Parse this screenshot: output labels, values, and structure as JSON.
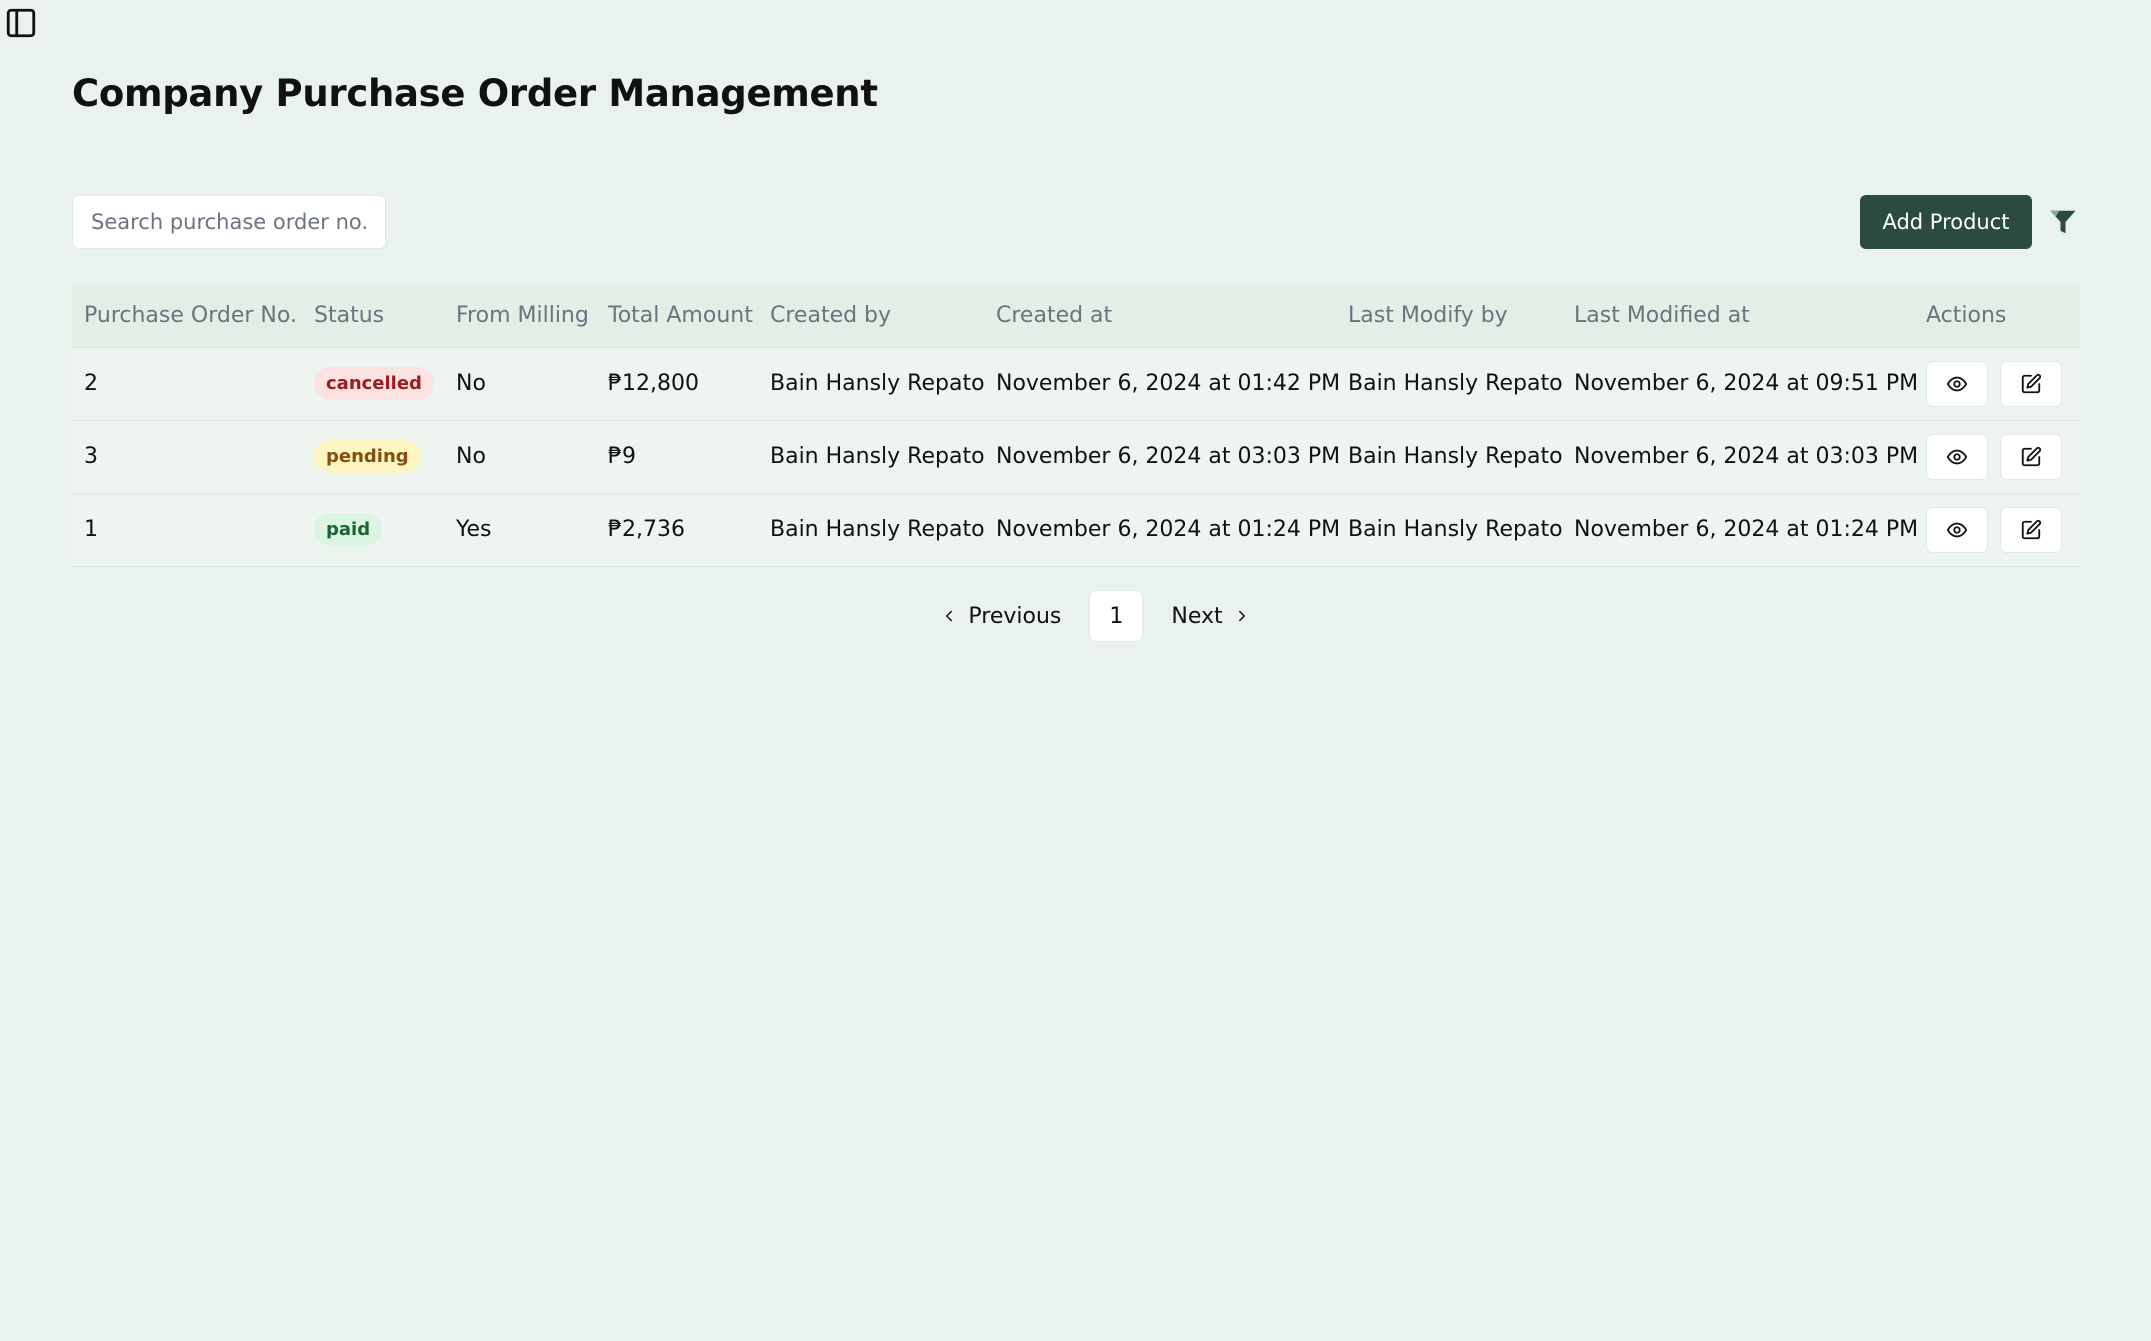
{
  "page": {
    "title": "Company Purchase Order Management"
  },
  "toolbar": {
    "search_placeholder": "Search purchase order no. . .",
    "add_button_label": "Add Product"
  },
  "icons": {
    "sidebar_toggle": "panel-left-icon",
    "filter": "filter-icon",
    "view": "eye-icon",
    "edit": "edit-icon",
    "prev": "chevron-left-icon",
    "next": "chevron-right-icon"
  },
  "table": {
    "columns": [
      "Purchase Order No.",
      "Status",
      "From Milling",
      "Total Amount",
      "Created by",
      "Created at",
      "Last Modify by",
      "Last Modified at",
      "Actions"
    ],
    "rows": [
      {
        "po_no": "2",
        "status": "cancelled",
        "from_milling": "No",
        "total_amount": "₱12,800",
        "created_by": "Bain Hansly Repato",
        "created_at": "November 6, 2024 at 01:42 PM",
        "last_modify_by": "Bain Hansly Repato",
        "last_modified_at": "November 6, 2024 at 09:51 PM"
      },
      {
        "po_no": "3",
        "status": "pending",
        "from_milling": "No",
        "total_amount": "₱9",
        "created_by": "Bain Hansly Repato",
        "created_at": "November 6, 2024 at 03:03 PM",
        "last_modify_by": "Bain Hansly Repato",
        "last_modified_at": "November 6, 2024 at 03:03 PM"
      },
      {
        "po_no": "1",
        "status": "paid",
        "from_milling": "Yes",
        "total_amount": "₱2,736",
        "created_by": "Bain Hansly Repato",
        "created_at": "November 6, 2024 at 01:24 PM",
        "last_modify_by": "Bain Hansly Repato",
        "last_modified_at": "November 6, 2024 at 01:24 PM"
      }
    ]
  },
  "status_colors": {
    "cancelled": {
      "bg": "#fde2e2",
      "fg": "#9b1c1c"
    },
    "pending": {
      "bg": "#fdf6c3",
      "fg": "#854d0e"
    },
    "paid": {
      "bg": "#dcf5e3",
      "fg": "#166534"
    }
  },
  "pagination": {
    "previous_label": "Previous",
    "current_page": "1",
    "next_label": "Next"
  },
  "colors": {
    "background": "#e9f2ec",
    "primary_button": "#2b4a42"
  }
}
